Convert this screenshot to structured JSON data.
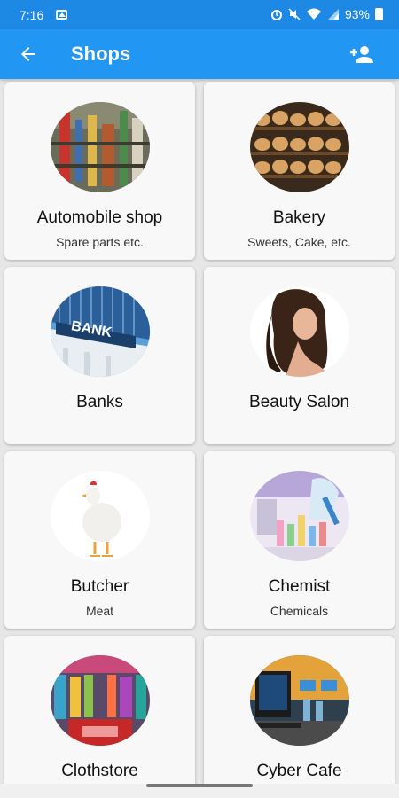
{
  "status_bar": {
    "time": "7:16",
    "battery": "93%"
  },
  "app_bar": {
    "title": "Shops"
  },
  "shops": [
    {
      "name": "Automobile shop",
      "subtitle": "Spare parts etc.",
      "icon": "auto-parts-image"
    },
    {
      "name": "Bakery",
      "subtitle": "Sweets, Cake, etc.",
      "icon": "bread-shelves-image"
    },
    {
      "name": "Banks",
      "subtitle": "",
      "icon": "bank-building-image"
    },
    {
      "name": "Beauty Salon",
      "subtitle": "",
      "icon": "woman-hair-image"
    },
    {
      "name": "Butcher",
      "subtitle": "Meat",
      "icon": "chicken-image"
    },
    {
      "name": "Chemist",
      "subtitle": "Chemicals",
      "icon": "lab-flasks-image"
    },
    {
      "name": "Clothstore",
      "subtitle": "",
      "icon": "clothing-store-image"
    },
    {
      "name": "Cyber Cafe",
      "subtitle": "",
      "icon": "computers-image"
    }
  ],
  "colors": {
    "app_bar": "#2196f3",
    "status_bar": "#1e88e5"
  }
}
